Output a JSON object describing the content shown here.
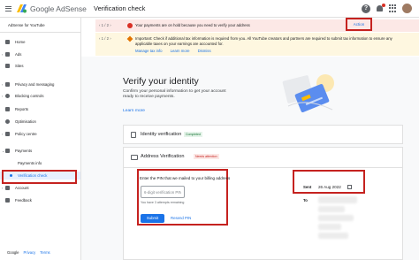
{
  "header": {
    "brand": "Google AdSense",
    "page_title": "Verification check",
    "help_icon": "help-icon",
    "bell_icon": "bell-icon",
    "apps_icon": "apps-grid-icon"
  },
  "sidebar": {
    "account": "AdSense for YouTube",
    "items": [
      {
        "label": "Home",
        "icon": "home-icon"
      },
      {
        "label": "Ads",
        "icon": "ads-icon"
      },
      {
        "label": "Sites",
        "icon": "sites-icon"
      },
      {
        "label": "Privacy and messaging",
        "icon": "privacy-icon"
      },
      {
        "label": "Blocking controls",
        "icon": "block-icon"
      },
      {
        "label": "Reports",
        "icon": "reports-icon"
      },
      {
        "label": "Optimisation",
        "icon": "optimisation-icon"
      },
      {
        "label": "Policy centre",
        "icon": "policy-icon"
      },
      {
        "label": "Payments",
        "icon": "payments-icon"
      },
      {
        "label": "Payments info"
      },
      {
        "label": "Verification check"
      },
      {
        "label": "Account",
        "icon": "account-icon"
      },
      {
        "label": "Feedback",
        "icon": "feedback-icon"
      }
    ],
    "footer": {
      "brand": "Google",
      "privacy": "Privacy",
      "terms": "Terms"
    }
  },
  "alerts": [
    {
      "pager": "1 / 2",
      "text": "Your payments are on hold because you need to verify your address",
      "action": "Action"
    },
    {
      "pager": "1 / 2",
      "text": "Important: Check if additional tax information is required from you. All YouTube creators and partners are required to submit tax information to ensure any applicable taxes on your earnings are accounted for.",
      "links": [
        "Manage tax info",
        "Learn more",
        "Dismiss"
      ]
    }
  ],
  "main": {
    "title": "Verify your identity",
    "description": "Confirm your personal information to get your account ready to receive payments.",
    "learn_more": "Learn more",
    "identity": {
      "title": "Identity verification",
      "status": "Completed"
    },
    "address": {
      "title": "Address Verification",
      "status": "Needs attention",
      "prompt": "Enter the PIN that we mailed to your billing address",
      "placeholder": "6-digit verification PIN",
      "attempts": "You have 3 attempts remaining",
      "submit": "Submit",
      "resend": "Resend PIN",
      "sent_label": "Sent",
      "sent_date": "26 Aug 2022",
      "to_label": "To"
    }
  }
}
